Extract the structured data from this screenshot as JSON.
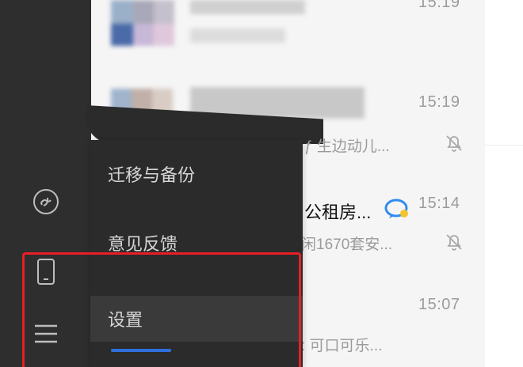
{
  "chats": [
    {
      "time": "15:19",
      "name": "",
      "preview": "ƒ 生边动儿...",
      "muted": true
    },
    {
      "time": "15:14",
      "name": "公租房...",
      "preview": "闲1670套安...",
      "muted": true
    },
    {
      "time": "15:07",
      "name": "",
      "preview": ": 可口可乐...",
      "muted": false
    }
  ],
  "top_time": "15:19",
  "menu": {
    "items": [
      {
        "label": "迁移与备份"
      },
      {
        "label": "意见反馈"
      },
      {
        "label": "设置"
      }
    ]
  },
  "colors": {
    "rail": "#2e2e2e",
    "menu": "#2b2b2b",
    "highlight": "#e81f25",
    "accent_blue": "#2f6fdc"
  },
  "icons": {
    "mini_program": "mini-program-icon",
    "phone": "phone-icon",
    "more": "more-menu-icon",
    "mute": "mute-bell-icon",
    "bubble": "chat-bubble-icon"
  }
}
